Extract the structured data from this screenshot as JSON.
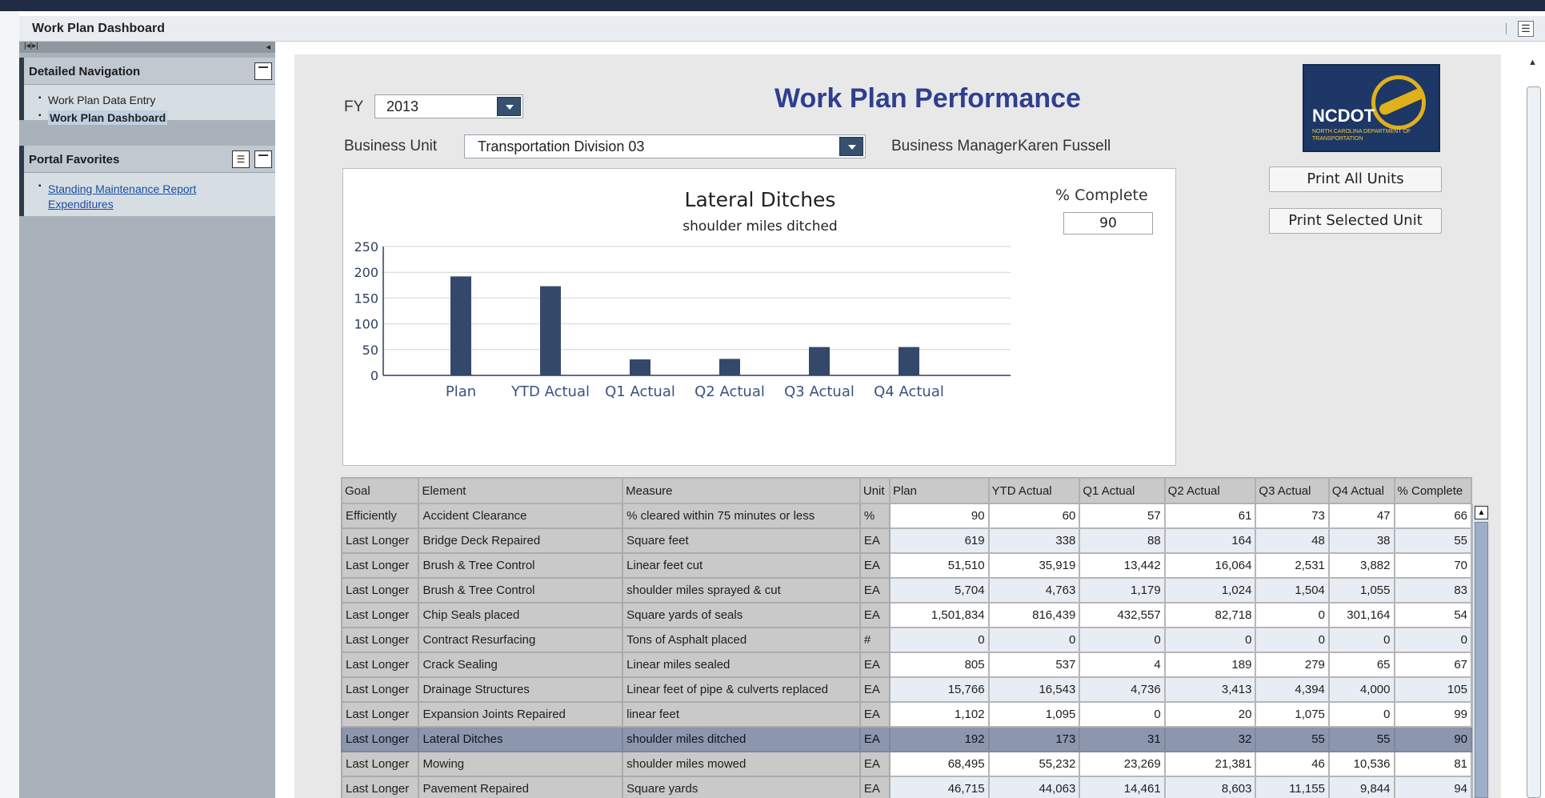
{
  "window": {
    "title": "Work Plan Dashboard"
  },
  "nav": {
    "detailed_navigation": {
      "title": "Detailed Navigation",
      "items": [
        {
          "label": "Work Plan Data Entry",
          "active": false
        },
        {
          "label": "Work Plan Dashboard",
          "active": true
        }
      ]
    },
    "portal_favorites": {
      "title": "Portal Favorites",
      "links": [
        {
          "label": "Standing Maintenance Report Expenditures"
        }
      ]
    }
  },
  "header": {
    "title": "Work Plan Performance",
    "fy_label": "FY",
    "fy_value": "2013",
    "business_unit_label": "Business Unit",
    "business_unit_value": "Transportation Division 03",
    "business_manager_label": "Business Manager",
    "business_manager_value": "Karen Fussell",
    "print_all_label": "Print All Units",
    "print_selected_label": "Print Selected Unit",
    "logo": {
      "name": "NCDOT",
      "sub": "NORTH CAROLINA DEPARTMENT OF TRANSPORTATION"
    }
  },
  "percent_complete": {
    "label": "% Complete",
    "value": "90"
  },
  "chart_data": {
    "type": "bar",
    "title": "Lateral Ditches",
    "subtitle": "shoulder miles ditched",
    "categories": [
      "Plan",
      "YTD Actual",
      "Q1 Actual",
      "Q2 Actual",
      "Q3 Actual",
      "Q4 Actual"
    ],
    "values": [
      192,
      173,
      31,
      32,
      55,
      55
    ],
    "ylim": [
      0,
      250
    ],
    "yticks": [
      0,
      50,
      100,
      150,
      200,
      250
    ],
    "bar_color": "#34496a",
    "grid": true
  },
  "table": {
    "columns": [
      "Goal",
      "Element",
      "Measure",
      "Unit",
      "Plan",
      "YTD Actual",
      "Q1 Actual",
      "Q2 Actual",
      "Q3 Actual",
      "Q4 Actual",
      "% Complete"
    ],
    "selected_row": 9,
    "rows": [
      [
        "Efficiently",
        "Accident Clearance",
        "% cleared within 75 minutes or less",
        "%",
        "90",
        "60",
        "57",
        "61",
        "73",
        "47",
        "66"
      ],
      [
        "Last Longer",
        "Bridge Deck Repaired",
        "Square feet",
        "EA",
        "619",
        "338",
        "88",
        "164",
        "48",
        "38",
        "55"
      ],
      [
        "Last Longer",
        "Brush & Tree Control",
        "Linear feet cut",
        "EA",
        "51,510",
        "35,919",
        "13,442",
        "16,064",
        "2,531",
        "3,882",
        "70"
      ],
      [
        "Last Longer",
        "Brush & Tree Control",
        "shoulder miles sprayed & cut",
        "EA",
        "5,704",
        "4,763",
        "1,179",
        "1,024",
        "1,504",
        "1,055",
        "83"
      ],
      [
        "Last Longer",
        "Chip Seals placed",
        "Square yards of seals",
        "EA",
        "1,501,834",
        "816,439",
        "432,557",
        "82,718",
        "0",
        "301,164",
        "54"
      ],
      [
        "Last Longer",
        "Contract Resurfacing",
        "Tons of Asphalt placed",
        "#",
        "0",
        "0",
        "0",
        "0",
        "0",
        "0",
        "0"
      ],
      [
        "Last Longer",
        "Crack Sealing",
        "Linear miles sealed",
        "EA",
        "805",
        "537",
        "4",
        "189",
        "279",
        "65",
        "67"
      ],
      [
        "Last Longer",
        "Drainage Structures",
        "Linear feet of pipe & culverts replaced",
        "EA",
        "15,766",
        "16,543",
        "4,736",
        "3,413",
        "4,394",
        "4,000",
        "105"
      ],
      [
        "Last Longer",
        "Expansion Joints Repaired",
        "linear feet",
        "EA",
        "1,102",
        "1,095",
        "0",
        "20",
        "1,075",
        "0",
        "99"
      ],
      [
        "Last Longer",
        "Lateral Ditches",
        "shoulder miles ditched",
        "EA",
        "192",
        "173",
        "31",
        "32",
        "55",
        "55",
        "90"
      ],
      [
        "Last Longer",
        "Mowing",
        "shoulder miles mowed",
        "EA",
        "68,495",
        "55,232",
        "23,269",
        "21,381",
        "46",
        "10,536",
        "81"
      ],
      [
        "Last Longer",
        "Pavement Repaired",
        "Square yards",
        "EA",
        "46,715",
        "44,063",
        "14,461",
        "8,603",
        "11,155",
        "9,844",
        "94"
      ]
    ]
  }
}
